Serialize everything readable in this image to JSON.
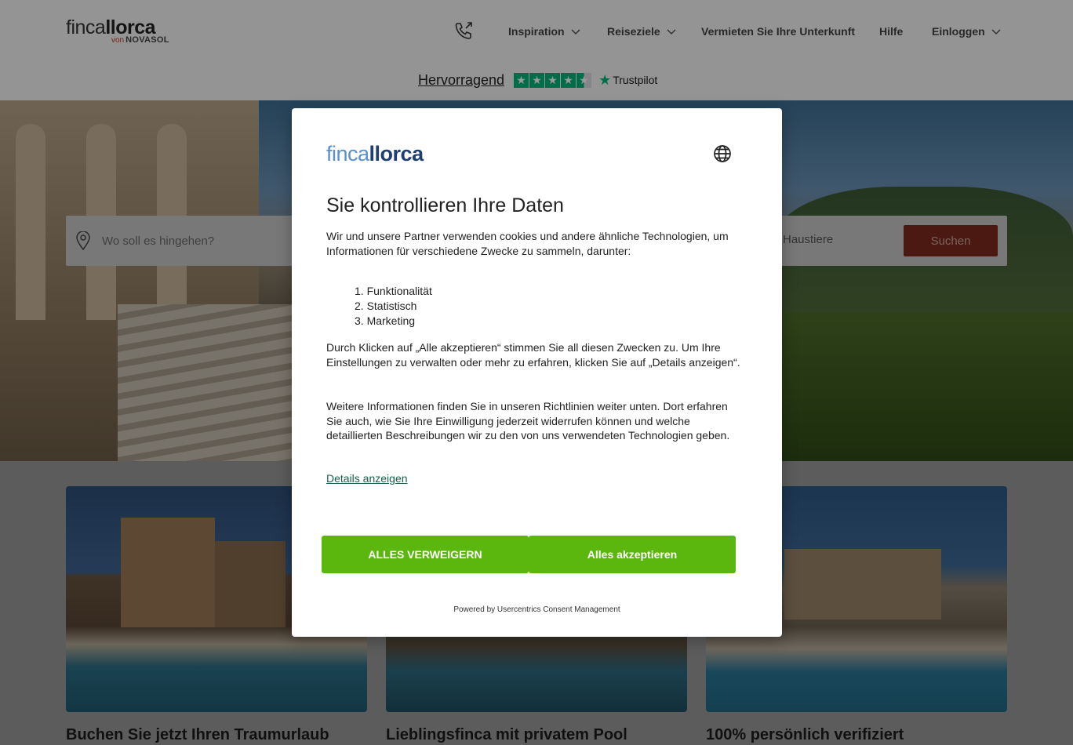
{
  "header": {
    "logo_main_thin": "finca",
    "logo_main_bold": "llorca",
    "logo_von": "von",
    "logo_novasol": "NOVASOL",
    "nav": [
      "Inspiration",
      "Reiseziele",
      "Vermieten Sie Ihre Unterkunft",
      "Hilfe",
      "Einloggen"
    ],
    "trustpilot_rating": "Hervorragend",
    "trustpilot_brand": "Trustpilot",
    "trustpilot_stars": 4.5
  },
  "search": {
    "placeholder": "Wo soll es hingehen?",
    "pets_label": "Haustiere",
    "submit_label": "Suchen"
  },
  "cards": [
    {
      "title": "Buchen Sie jetzt Ihren Traumurlaub"
    },
    {
      "title": "Lieblingsfinca mit privatem Pool"
    },
    {
      "title": "100% persönlich verifiziert"
    }
  ],
  "dialog": {
    "logo_thin": "finca",
    "logo_bold": "llorca",
    "title": "Sie kontrollieren Ihre Daten",
    "intro": "Wir und unsere Partner verwenden cookies und andere ähnliche Technologien, um Informationen für verschiedene Zwecke zu sammeln, darunter:",
    "purposes": [
      "1. Funktionalität",
      "2. Statistisch",
      "3. Marketing"
    ],
    "para2": "Durch Klicken auf „Alle akzeptieren“ stimmen Sie all diesen Zwecken zu. Um Ihre Einstellungen zu verwalten oder mehr zu erfahren, klicken Sie auf „Details anzeigen“.",
    "para3": "Weitere Informationen finden Sie in unseren Richtlinien weiter unten. Dort erfahren Sie auch, wie Sie Ihre Einwilligung jederzeit widerrufen können und welche detaillierten Beschreibungen wir zu den von uns verwendeten Technologien geben.",
    "details_link": "Details anzeigen",
    "deny_label": "ALLES VERWEIGERN",
    "accept_label": "Alles akzeptieren",
    "powered_by": "Powered by Usercentrics Consent Management",
    "button_color": "#5bb70e"
  }
}
